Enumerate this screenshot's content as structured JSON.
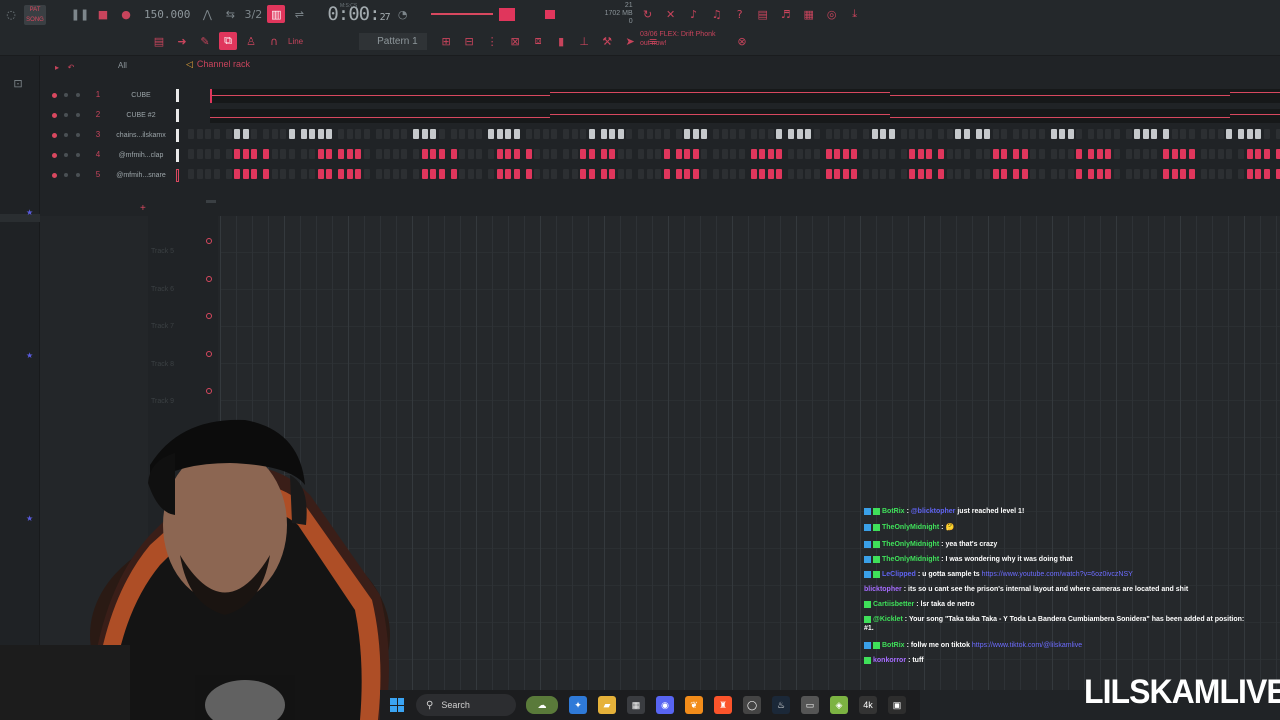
{
  "toolbar": {
    "song_badge": "PAT SONG",
    "tempo": "150.000",
    "time_main": "0:00",
    "time_sec": "27",
    "time_sub": "M:S:CS",
    "cpu_top": "21",
    "cpu_mem": "1702 MB",
    "cpu_poly": "0",
    "pattern": "Pattern 1",
    "snap_label": "Line",
    "hint_line1": "03/06 FLEX: Drift Phonk",
    "hint_line2": "out now!"
  },
  "rack": {
    "filter": "All",
    "title": "Channel rack",
    "channels": [
      {
        "num": "1",
        "name": "CUBE"
      },
      {
        "num": "2",
        "name": "CUBE #2"
      },
      {
        "num": "3",
        "name": "chains...ilskamx"
      },
      {
        "num": "4",
        "name": "@mfmih...clap"
      },
      {
        "num": "5",
        "name": "@mfmih...snare"
      }
    ],
    "add": "+"
  },
  "playlist": {
    "tracks": [
      "Track 5",
      "Track 6",
      "Track 7",
      "Track 8",
      "Track 9"
    ]
  },
  "chat": {
    "lines": [
      {
        "user": "BotRix",
        "color": "#3fe05a",
        "text": "@blicktopher just reached level 1!",
        "mention": "@blicktopher"
      },
      {
        "user": "TheOnlyMidnight",
        "color": "#3fe05a",
        "text": "🤔"
      },
      {
        "user": "TheOnlyMidnight",
        "color": "#3fe05a",
        "text": "yea that's crazy"
      },
      {
        "user": "TheOnlyMidnight",
        "color": "#3fe05a",
        "text": "I was wondering why it was doing that"
      },
      {
        "user": "LeClipped",
        "color": "#5f63f0",
        "text": "u gotta sample ts",
        "link": "https://www.youtube.com/watch?v=6oz0ivczNSY"
      },
      {
        "user": "blicktopher",
        "color": "#a56bff",
        "text": "its so u cant see the prison's internal layout and where cameras are located and shit"
      },
      {
        "user": "Cartiisbetter",
        "color": "#3fe05a",
        "text": "lsr taka de netro"
      },
      {
        "user": "@Kicklet",
        "color": "#3fe05a",
        "text": "Your song \"Taka taka Taka - Y Toda La Bandera Cumbiambera Sonidera\" has been added at position:",
        "cont": "#1."
      },
      {
        "user": "BotRix",
        "color": "#3fe05a",
        "text": "follw me on tiktok",
        "link": "https://www.tiktok.com/@lilskamlive"
      },
      {
        "user": "konkorror",
        "color": "#a56bff",
        "text": "tuff"
      }
    ]
  },
  "taskbar": {
    "search": "Search",
    "apps": [
      "widget-app",
      "copilot-app",
      "files-app",
      "store-app",
      "discord-app",
      "fl-studio-app",
      "brave-app",
      "chrome-app",
      "steam-app",
      "misc-app",
      "layers-app",
      "4k-app",
      "terminal-app"
    ]
  },
  "watermark": "LILSKAMLIVE"
}
